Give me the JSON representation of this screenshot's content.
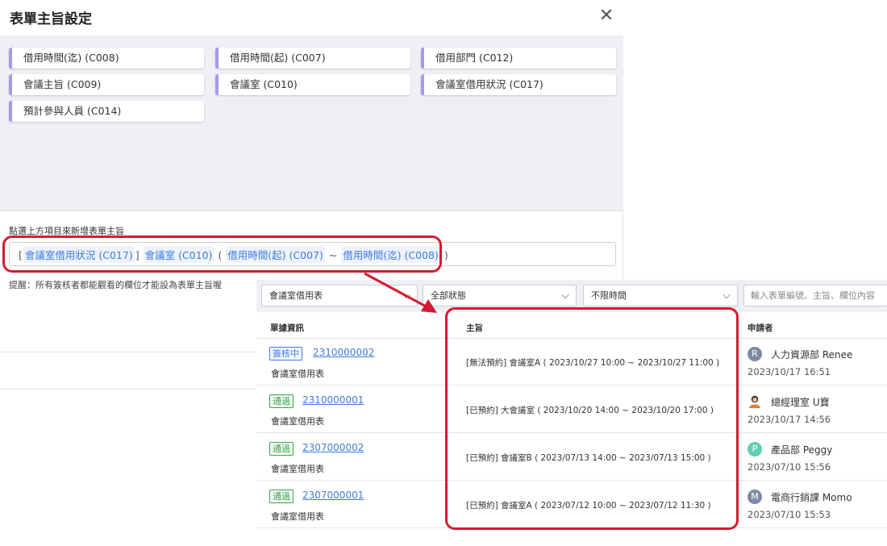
{
  "dialog": {
    "title": "表單主旨設定",
    "close_icon": "✕",
    "fields": [
      {
        "label": "借用時間(迄) (C008)"
      },
      {
        "label": "借用時間(起) (C007)"
      },
      {
        "label": "借用部門 (C012)"
      },
      {
        "label": "會議主旨 (C009)"
      },
      {
        "label": "會議室 (C010)"
      },
      {
        "label": "會議室借用狀況 (C017)"
      },
      {
        "label": "預計參與人員 (C014)"
      }
    ],
    "hint": "點選上方項目來新增表單主旨",
    "subject_template": {
      "open1": "[",
      "tok1": "會議室借用狀況 (C017)",
      "close1": "]",
      "tok2": "會議室 (C010)",
      "open2": "(",
      "tok3": "借用時間(起) (C007)",
      "tilde": "~",
      "tok4": "借用時間(迄) (C008)",
      "close2": ")"
    },
    "note": "提醒：所有簽核者都能觀看的欄位才能設為表單主旨喔"
  },
  "panel": {
    "filters": {
      "form": "會議室借用表",
      "status": "全部狀態",
      "time": "不限時間",
      "search_placeholder": "輸入表單編號、主旨、欄位內容"
    },
    "columns": {
      "info": "單據資訊",
      "subject": "主旨",
      "applicant": "申請者"
    },
    "rows": [
      {
        "status": "簽核中",
        "status_color": "#3e7be0",
        "no": "2310000002",
        "form": "會議室借用表",
        "subject": "[無法預約] 會議室A ( 2023/10/27 10:00 ~ 2023/10/27 11:00 )",
        "avatar": "R",
        "avatar_color": "#7d8aa3",
        "applicant": "人力資源部 Renee",
        "date": "2023/10/17 16:51"
      },
      {
        "status": "通過",
        "status_color": "#3aa34c",
        "no": "2310000001",
        "form": "會議室借用表",
        "subject": "[已預約] 大會議室 ( 2023/10/20 14:00 ~ 2023/10/20 17:00 )",
        "avatar": "",
        "avatar_color": "#e07a2f",
        "applicant": "總經理室 U寶",
        "date": "2023/10/17 14:56"
      },
      {
        "status": "通過",
        "status_color": "#3aa34c",
        "no": "2307000002",
        "form": "會議室借用表",
        "subject": "[已預約] 會議室B ( 2023/07/13 14:00 ~ 2023/07/13 15:00 )",
        "avatar": "P",
        "avatar_color": "#5fcfb6",
        "applicant": "產品部 Peggy",
        "date": "2023/07/10 15:56"
      },
      {
        "status": "通過",
        "status_color": "#3aa34c",
        "no": "2307000001",
        "form": "會議室借用表",
        "subject": "[已預約] 會議室A ( 2023/07/12 10:00 ~ 2023/07/12 11:30 )",
        "avatar": "M",
        "avatar_color": "#7d8aa3",
        "applicant": "電商行銷課 Momo",
        "date": "2023/07/10 15:53"
      }
    ]
  },
  "colors": {
    "accent": "#3e7be0",
    "highlight": "#d41b31",
    "chip_bar": "#a59be8"
  }
}
